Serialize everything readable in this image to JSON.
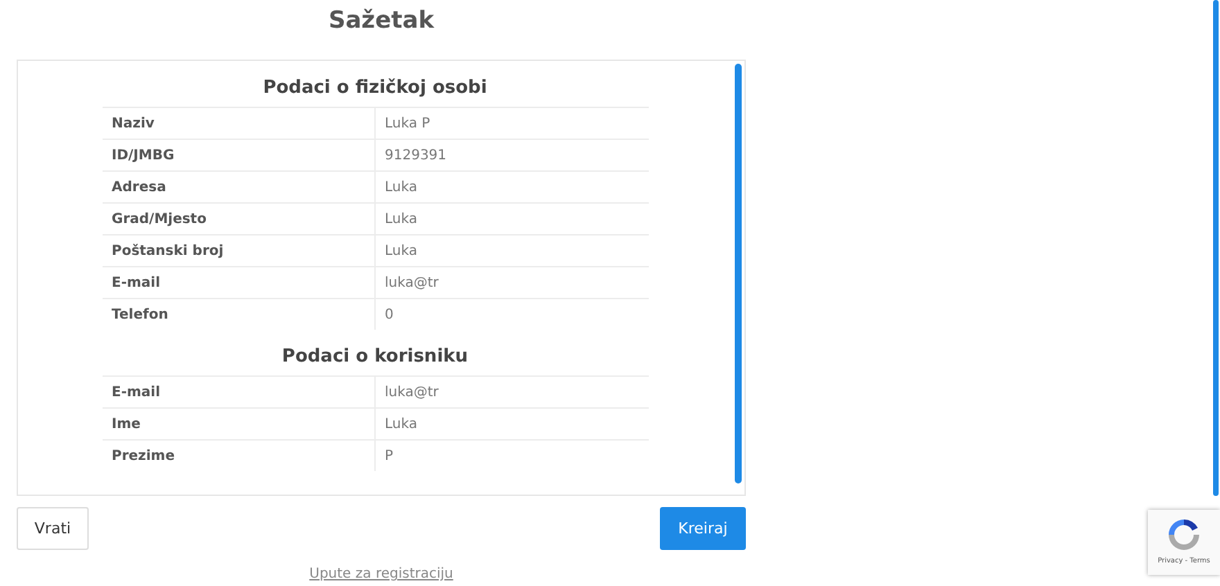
{
  "title": "Sažetak",
  "sections": [
    {
      "heading": "Podaci o fizičkoj osobi",
      "rows": [
        {
          "label": "Naziv",
          "value": "Luka P"
        },
        {
          "label": "ID/JMBG",
          "value": "9129391"
        },
        {
          "label": "Adresa",
          "value": "Luka"
        },
        {
          "label": "Grad/Mjesto",
          "value": "Luka"
        },
        {
          "label": "Poštanski broj",
          "value": "Luka"
        },
        {
          "label": "E-mail",
          "value": "luka@tr"
        },
        {
          "label": "Telefon",
          "value": "0"
        }
      ]
    },
    {
      "heading": "Podaci o korisniku",
      "rows": [
        {
          "label": "E-mail",
          "value": "luka@tr"
        },
        {
          "label": "Ime",
          "value": "Luka"
        },
        {
          "label": "Prezime",
          "value": "P"
        }
      ]
    }
  ],
  "buttons": {
    "back": "Vrati",
    "create": "Kreiraj"
  },
  "link": "Upute za registraciju",
  "recaptcha": {
    "links": "Privacy - Terms"
  }
}
